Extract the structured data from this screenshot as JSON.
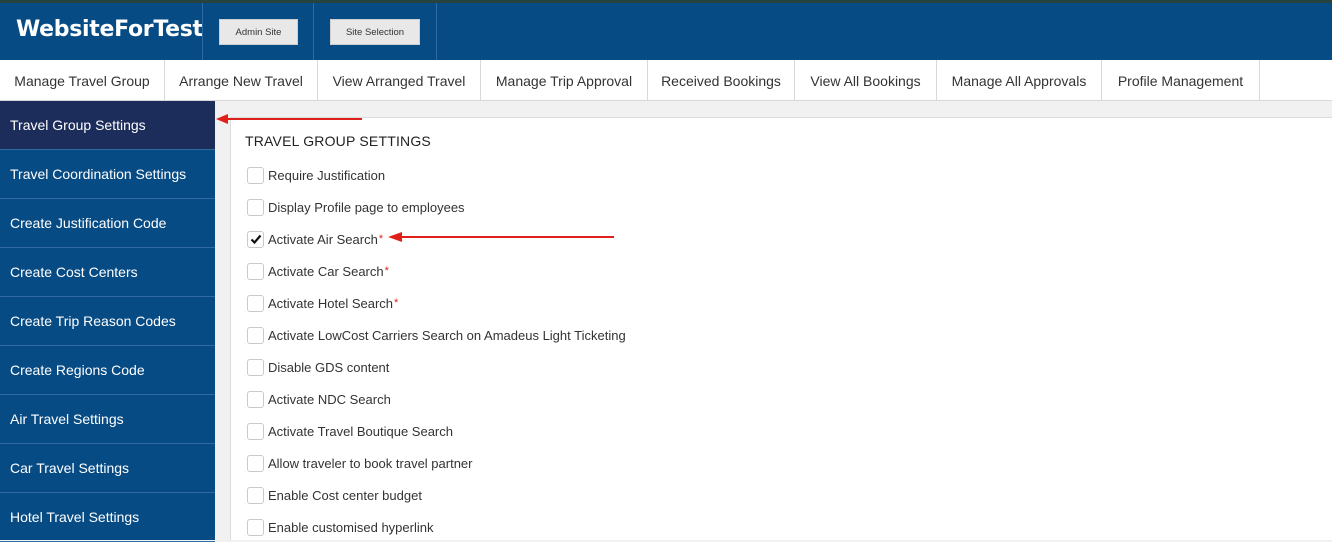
{
  "header": {
    "brand": "WebsiteForTest",
    "buttons": [
      "Admin Site",
      "Site Selection"
    ]
  },
  "nav": {
    "items": [
      "Manage Travel Group",
      "Arrange New Travel",
      "View Arranged Travel",
      "Manage Trip Approval",
      "Received Bookings",
      "View All Bookings",
      "Manage All Approvals",
      "Profile Management"
    ]
  },
  "sidebar": {
    "items": [
      {
        "label": "Travel Group Settings",
        "active": true
      },
      {
        "label": "Travel Coordination Settings",
        "active": false
      },
      {
        "label": "Create Justification Code",
        "active": false
      },
      {
        "label": "Create Cost Centers",
        "active": false
      },
      {
        "label": "Create Trip Reason Codes",
        "active": false
      },
      {
        "label": "Create Regions Code",
        "active": false
      },
      {
        "label": "Air Travel Settings",
        "active": false
      },
      {
        "label": "Car Travel Settings",
        "active": false
      },
      {
        "label": "Hotel Travel Settings",
        "active": false
      }
    ]
  },
  "content": {
    "title": "TRAVEL GROUP SETTINGS",
    "required_mark": "*",
    "options": [
      {
        "label": "Require Justification",
        "checked": false,
        "required": false
      },
      {
        "label": "Display Profile page to employees",
        "checked": false,
        "required": false
      },
      {
        "label": "Activate Air Search",
        "checked": true,
        "required": true
      },
      {
        "label": "Activate Car Search",
        "checked": false,
        "required": true
      },
      {
        "label": "Activate Hotel Search",
        "checked": false,
        "required": true
      },
      {
        "label": "Activate LowCost Carriers Search on Amadeus Light Ticketing",
        "checked": false,
        "required": false
      },
      {
        "label": "Disable GDS content",
        "checked": false,
        "required": false
      },
      {
        "label": "Activate NDC Search",
        "checked": false,
        "required": false
      },
      {
        "label": "Activate Travel Boutique Search",
        "checked": false,
        "required": false
      },
      {
        "label": "Allow traveler to book travel partner",
        "checked": false,
        "required": false
      },
      {
        "label": "Enable Cost center budget",
        "checked": false,
        "required": false
      },
      {
        "label": "Enable customised hyperlink",
        "checked": false,
        "required": false
      }
    ]
  },
  "colors": {
    "header_bg": "#074b85",
    "sidebar_active": "#1c2d5c",
    "annotation_arrow": "#e0201a"
  }
}
